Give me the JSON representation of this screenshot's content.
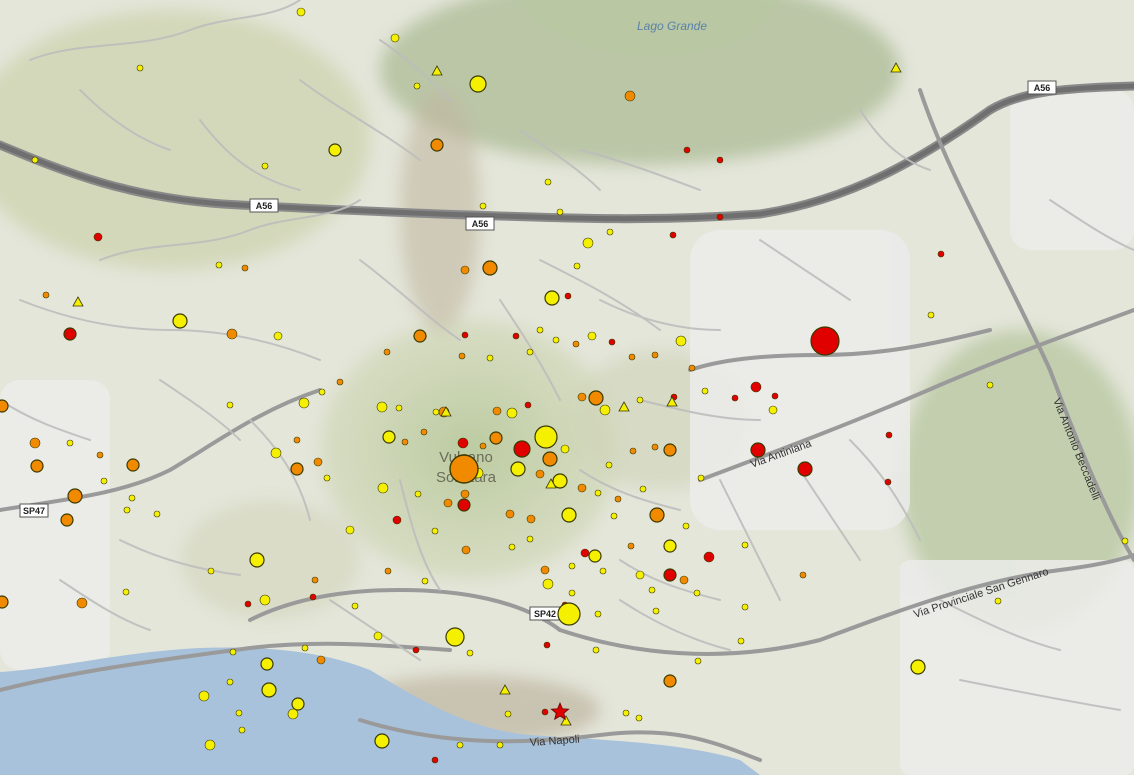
{
  "map": {
    "labels": {
      "lake": "Lago Grande",
      "volcano_line1": "Vulcano",
      "volcano_line2": "Solfatara",
      "road_antiniana": "Via Antiniana",
      "road_beccadelli": "Via Antonio Beccadelli",
      "road_sangennaro": "Via Provinciale San Gennaro",
      "road_napoli": "Via Napoli"
    },
    "shields": {
      "a56_west": "A56",
      "a56_center": "A56",
      "a56_east": "A56",
      "sp47": "SP47",
      "sp42": "SP42"
    },
    "marker_colors": {
      "deep": "#e00000",
      "mid": "#f28a00",
      "shallow": "#f5ef00",
      "outline": "#3a3a00"
    }
  }
}
